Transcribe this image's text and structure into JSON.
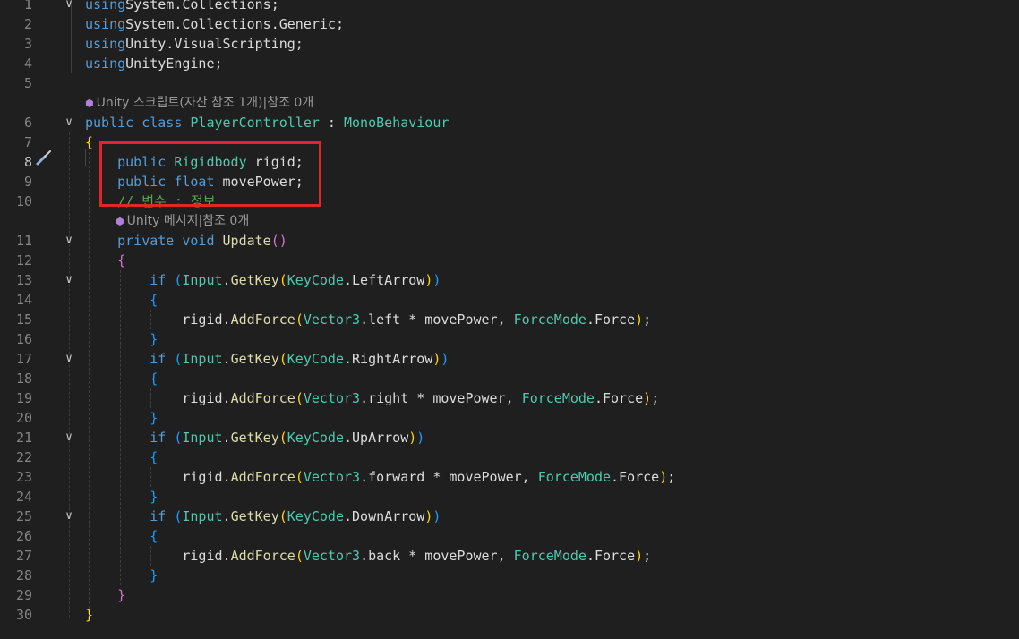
{
  "editor": {
    "lines": [
      {
        "num": "1",
        "fold": "∨",
        "tokens": [
          [
            "kw",
            "using"
          ],
          [
            "",
            "System.Collections;"
          ]
        ]
      },
      {
        "num": "2",
        "fold": "",
        "tokens": [
          [
            "kw",
            "using"
          ],
          [
            "",
            "System.Collections.Generic;"
          ]
        ]
      },
      {
        "num": "3",
        "fold": "",
        "tokens": [
          [
            "kw",
            "using"
          ],
          [
            "",
            "Unity.VisualScripting;"
          ]
        ]
      },
      {
        "num": "4",
        "fold": "",
        "tokens": [
          [
            "kw",
            "using"
          ],
          [
            "",
            "UnityEngine;"
          ]
        ]
      },
      {
        "num": "5",
        "fold": "",
        "tokens": []
      },
      {
        "lens": "Unity 스크립트(자산 참조 1개)|참조 0개"
      },
      {
        "num": "6",
        "fold": "∨",
        "tokens": [
          [
            "kw",
            "public class "
          ],
          [
            "ty",
            "PlayerController"
          ],
          [
            "",
            " : "
          ],
          [
            "ty",
            "MonoBehaviour"
          ]
        ]
      },
      {
        "num": "7",
        "fold": "",
        "tokens": [
          [
            "p1",
            "{"
          ]
        ]
      },
      {
        "num": "8",
        "fold": "",
        "active": true,
        "tokens": [
          [
            "",
            "    "
          ],
          [
            "kw",
            "public "
          ],
          [
            "ty",
            "Rigidbody"
          ],
          [
            "",
            " rigid;"
          ]
        ]
      },
      {
        "num": "9",
        "fold": "",
        "tokens": [
          [
            "",
            "    "
          ],
          [
            "kw",
            "public float"
          ],
          [
            "",
            " movePower;"
          ]
        ]
      },
      {
        "num": "10",
        "fold": "",
        "tokens": [
          [
            "",
            "    "
          ],
          [
            "cm",
            "// 변수 : 정보"
          ]
        ]
      },
      {
        "lens": "Unity 메시지|참조 0개",
        "indent": 1
      },
      {
        "num": "11",
        "fold": "∨",
        "tokens": [
          [
            "",
            "    "
          ],
          [
            "kw",
            "private void "
          ],
          [
            "mt",
            "Update"
          ],
          [
            "p2",
            "()"
          ]
        ]
      },
      {
        "num": "12",
        "fold": "",
        "tokens": [
          [
            "",
            "    "
          ],
          [
            "p2",
            "{"
          ]
        ]
      },
      {
        "num": "13",
        "fold": "∨",
        "tokens": [
          [
            "",
            "        "
          ],
          [
            "kw",
            "if "
          ],
          [
            "p3",
            "("
          ],
          [
            "ty",
            "Input"
          ],
          [
            "",
            "."
          ],
          [
            "mt",
            "GetKey"
          ],
          [
            "p1",
            "("
          ],
          [
            "ty",
            "KeyCode"
          ],
          [
            "",
            ".LeftArrow"
          ],
          [
            "p1",
            ")"
          ],
          [
            "p3",
            ")"
          ]
        ]
      },
      {
        "num": "14",
        "fold": "",
        "tokens": [
          [
            "",
            "        "
          ],
          [
            "p3",
            "{"
          ]
        ]
      },
      {
        "num": "15",
        "fold": "",
        "tokens": [
          [
            "",
            "            rigid."
          ],
          [
            "mt",
            "AddForce"
          ],
          [
            "p1",
            "("
          ],
          [
            "ty",
            "Vector3"
          ],
          [
            "",
            ".left * movePower, "
          ],
          [
            "ty",
            "ForceMode"
          ],
          [
            "",
            ".Force"
          ],
          [
            "p1",
            ")"
          ],
          [
            "",
            ";"
          ]
        ]
      },
      {
        "num": "16",
        "fold": "",
        "tokens": [
          [
            "",
            "        "
          ],
          [
            "p3",
            "}"
          ]
        ]
      },
      {
        "num": "17",
        "fold": "∨",
        "tokens": [
          [
            "",
            "        "
          ],
          [
            "kw",
            "if "
          ],
          [
            "p3",
            "("
          ],
          [
            "ty",
            "Input"
          ],
          [
            "",
            "."
          ],
          [
            "mt",
            "GetKey"
          ],
          [
            "p1",
            "("
          ],
          [
            "ty",
            "KeyCode"
          ],
          [
            "",
            ".RightArrow"
          ],
          [
            "p1",
            ")"
          ],
          [
            "p3",
            ")"
          ]
        ]
      },
      {
        "num": "18",
        "fold": "",
        "tokens": [
          [
            "",
            "        "
          ],
          [
            "p3",
            "{"
          ]
        ]
      },
      {
        "num": "19",
        "fold": "",
        "tokens": [
          [
            "",
            "            rigid."
          ],
          [
            "mt",
            "AddForce"
          ],
          [
            "p1",
            "("
          ],
          [
            "ty",
            "Vector3"
          ],
          [
            "",
            ".right * movePower, "
          ],
          [
            "ty",
            "ForceMode"
          ],
          [
            "",
            ".Force"
          ],
          [
            "p1",
            ")"
          ],
          [
            "",
            ";"
          ]
        ]
      },
      {
        "num": "20",
        "fold": "",
        "tokens": [
          [
            "",
            "        "
          ],
          [
            "p3",
            "}"
          ]
        ]
      },
      {
        "num": "21",
        "fold": "∨",
        "tokens": [
          [
            "",
            "        "
          ],
          [
            "kw",
            "if "
          ],
          [
            "p3",
            "("
          ],
          [
            "ty",
            "Input"
          ],
          [
            "",
            "."
          ],
          [
            "mt",
            "GetKey"
          ],
          [
            "p1",
            "("
          ],
          [
            "ty",
            "KeyCode"
          ],
          [
            "",
            ".UpArrow"
          ],
          [
            "p1",
            ")"
          ],
          [
            "p3",
            ")"
          ]
        ]
      },
      {
        "num": "22",
        "fold": "",
        "tokens": [
          [
            "",
            "        "
          ],
          [
            "p3",
            "{"
          ]
        ]
      },
      {
        "num": "23",
        "fold": "",
        "tokens": [
          [
            "",
            "            rigid."
          ],
          [
            "mt",
            "AddForce"
          ],
          [
            "p1",
            "("
          ],
          [
            "ty",
            "Vector3"
          ],
          [
            "",
            ".forward * movePower, "
          ],
          [
            "ty",
            "ForceMode"
          ],
          [
            "",
            ".Force"
          ],
          [
            "p1",
            ")"
          ],
          [
            "",
            ";"
          ]
        ]
      },
      {
        "num": "24",
        "fold": "",
        "tokens": [
          [
            "",
            "        "
          ],
          [
            "p3",
            "}"
          ]
        ]
      },
      {
        "num": "25",
        "fold": "∨",
        "tokens": [
          [
            "",
            "        "
          ],
          [
            "kw",
            "if "
          ],
          [
            "p3",
            "("
          ],
          [
            "ty",
            "Input"
          ],
          [
            "",
            "."
          ],
          [
            "mt",
            "GetKey"
          ],
          [
            "p1",
            "("
          ],
          [
            "ty",
            "KeyCode"
          ],
          [
            "",
            ".DownArrow"
          ],
          [
            "p1",
            ")"
          ],
          [
            "p3",
            ")"
          ]
        ]
      },
      {
        "num": "26",
        "fold": "",
        "tokens": [
          [
            "",
            "        "
          ],
          [
            "p3",
            "{"
          ]
        ]
      },
      {
        "num": "27",
        "fold": "",
        "tokens": [
          [
            "",
            "            rigid."
          ],
          [
            "mt",
            "AddForce"
          ],
          [
            "p1",
            "("
          ],
          [
            "ty",
            "Vector3"
          ],
          [
            "",
            ".back * movePower, "
          ],
          [
            "ty",
            "ForceMode"
          ],
          [
            "",
            ".Force"
          ],
          [
            "p1",
            ")"
          ],
          [
            "",
            ";"
          ]
        ]
      },
      {
        "num": "28",
        "fold": "",
        "tokens": [
          [
            "",
            "        "
          ],
          [
            "p3",
            "}"
          ]
        ]
      },
      {
        "num": "29",
        "fold": "",
        "tokens": [
          [
            "",
            "    "
          ],
          [
            "p2",
            "}"
          ]
        ]
      },
      {
        "num": "30",
        "fold": "",
        "tokens": [
          [
            "p1",
            "}"
          ]
        ]
      }
    ]
  },
  "colors": {
    "background": "#1f1f1f",
    "keyword": "#569cd6",
    "type": "#4ec9b0",
    "method": "#dcdcaa",
    "comment": "#57a64a",
    "highlight_box": "#e0252b"
  },
  "icons": {
    "lens_icon": "unity-cube-icon",
    "gutter_icon": "quick-action-screwdriver-icon"
  }
}
